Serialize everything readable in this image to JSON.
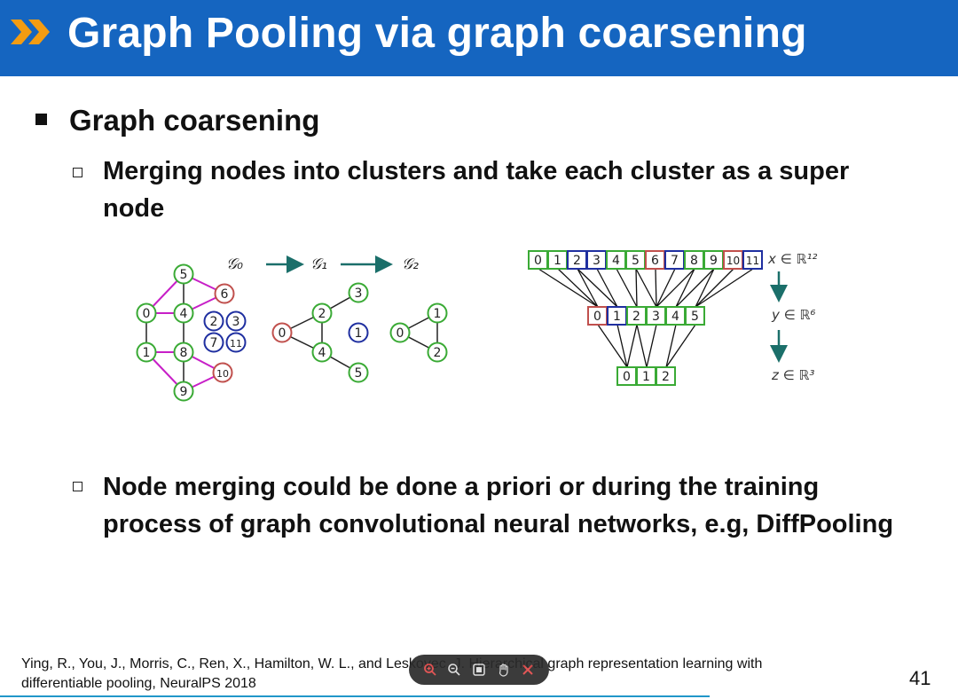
{
  "slide": {
    "title": "Graph Pooling via graph coarsening",
    "bullet1": "Graph coarsening",
    "sub1": "Merging nodes into clusters and take each cluster as a super node",
    "sub2": "Node merging could be done a priori or during the training process of graph convolutional neural networks, e.g, DiffPooling",
    "reference_line1": "Ying, R., You, J., Morris, C., Ren, X., Hamilton, W. L., and Leskovec, J. Hierarchical graph representation learning with",
    "reference_line2": "differentiable pooling, NeuralPS 2018",
    "page_number": "41"
  },
  "figure": {
    "graph_labels": [
      "𝒢₀",
      "𝒢₁",
      "𝒢₂"
    ],
    "g0_nodes": [
      "5",
      "6",
      "0",
      "4",
      "2",
      "3",
      "7",
      "11",
      "1",
      "8",
      "10",
      "9"
    ],
    "g1_nodes": [
      "3",
      "2",
      "0",
      "1",
      "4",
      "5"
    ],
    "g2_nodes": [
      "1",
      "0",
      "2"
    ],
    "row_x": [
      "0",
      "1",
      "2",
      "3",
      "4",
      "5",
      "6",
      "7",
      "8",
      "9",
      "10",
      "11"
    ],
    "row_y": [
      "0",
      "1",
      "2",
      "3",
      "4",
      "5"
    ],
    "row_z": [
      "0",
      "1",
      "2"
    ],
    "label_x": "x ∈ ℝ¹²",
    "label_y": "y ∈ ℝ⁶",
    "label_z": "z ∈ ℝ³"
  },
  "colors": {
    "title_bar": "#1565c0",
    "chevron": "#f39c12",
    "node_green": "#3aaa35",
    "node_red": "#c0504d",
    "node_blue": "#1f2fa0",
    "edge_magenta": "#c71fc7",
    "arrow_teal": "#1b6f6a"
  },
  "toolbar_icons": [
    "zoom-in-icon",
    "zoom-out-icon",
    "fit-page-icon",
    "hand-icon",
    "close-icon"
  ]
}
